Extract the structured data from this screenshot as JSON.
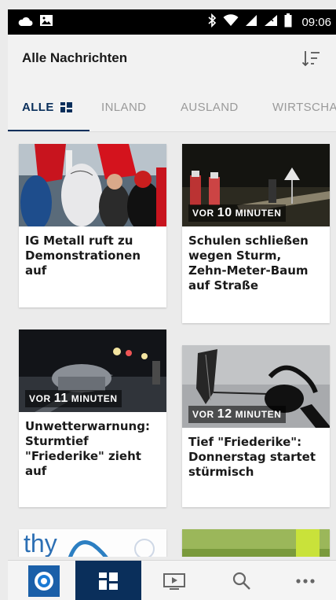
{
  "status_bar": {
    "time": "09:06"
  },
  "app_bar": {
    "title": "Alle Nachrichten"
  },
  "tabs": [
    {
      "label": "ALLE",
      "active": true
    },
    {
      "label": "INLAND",
      "active": false
    },
    {
      "label": "AUSLAND",
      "active": false
    },
    {
      "label": "WIRTSCHA",
      "active": false
    }
  ],
  "cards": [
    {
      "badge_prefix": "",
      "badge_num": "",
      "badge_suffix": "",
      "title": "IG Metall ruft zu Demonstrationen auf"
    },
    {
      "badge_prefix": "VOR ",
      "badge_num": "10",
      "badge_suffix": " MINUTEN",
      "title": "Schulen schließen wegen Sturm, Zehn-Meter-Baum auf Straße"
    },
    {
      "badge_prefix": "VOR ",
      "badge_num": "11",
      "badge_suffix": " MINUTEN",
      "title": "Unwetterwarnung: Sturmtief \"Friederike\" zieht auf"
    },
    {
      "badge_prefix": "VOR ",
      "badge_num": "12",
      "badge_suffix": " MINUTEN",
      "title": "Tief \"Friederike\": Donnerstag startet stürmisch"
    },
    {
      "title": ""
    },
    {
      "title": ""
    }
  ],
  "partial_card_text": "thy",
  "bottom_nav": [
    "app-logo",
    "news-grid",
    "video",
    "search",
    "more"
  ],
  "colors": {
    "accent": "#0a2f5b",
    "tab_inactive": "#9a9a9a",
    "status_bar": "#000000"
  }
}
